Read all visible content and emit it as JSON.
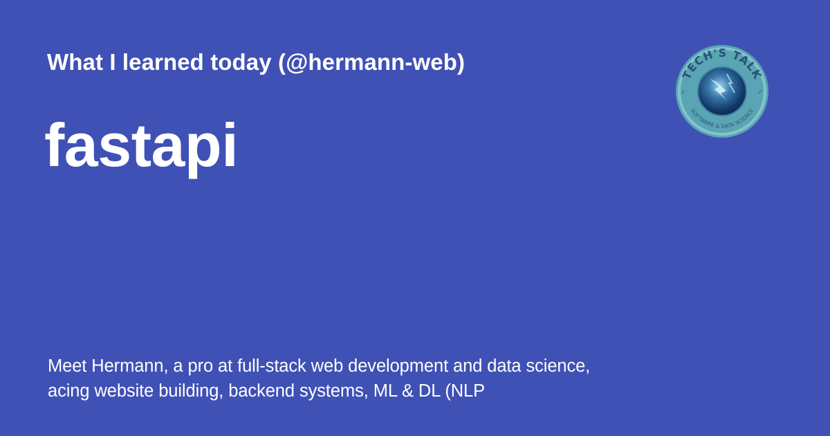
{
  "header": {
    "title": "What I learned today (@hermann-web)"
  },
  "main": {
    "topic": "fastapi",
    "description": "Meet Hermann, a pro at full-stack web development and data science, acing website building, backend systems, ML & DL (NLP"
  },
  "logo": {
    "top_text": "TECH'S TALK",
    "bottom_text": "SOFTWARE & DATA SCIENCE",
    "icon": "tech-talk-badge-icon"
  },
  "colors": {
    "background": "#3f51b5",
    "text": "#ffffff",
    "logo_ring": "#5aa4b3",
    "logo_text": "#27527a",
    "logo_center": "#1a3f77"
  }
}
